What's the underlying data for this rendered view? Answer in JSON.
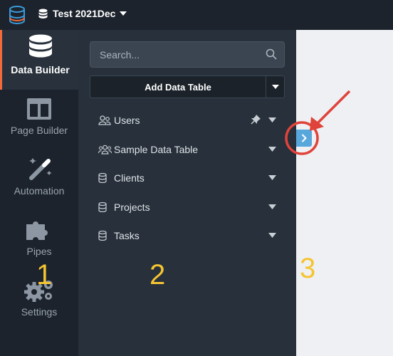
{
  "topbar": {
    "project_name": "Test 2021Dec"
  },
  "rail": {
    "items": [
      {
        "label": "Data Builder"
      },
      {
        "label": "Page Builder"
      },
      {
        "label": "Automation"
      },
      {
        "label": "Pipes"
      },
      {
        "label": "Settings"
      }
    ]
  },
  "panel": {
    "search_placeholder": "Search...",
    "add_button_label": "Add Data Table",
    "tables": [
      {
        "label": "Users",
        "icon": "users-icon"
      },
      {
        "label": "Sample Data Table",
        "icon": "users-group-icon"
      },
      {
        "label": "Clients",
        "icon": "database-icon"
      },
      {
        "label": "Projects",
        "icon": "database-icon"
      },
      {
        "label": "Tasks",
        "icon": "database-icon"
      }
    ]
  },
  "annotations": {
    "n1": "1",
    "n2": "2",
    "n3": "3"
  },
  "colors": {
    "accent": "#f26b3a",
    "expander": "#58a7dc",
    "annotation_red": "#e0433a",
    "annotation_yellow": "#f5c431"
  }
}
